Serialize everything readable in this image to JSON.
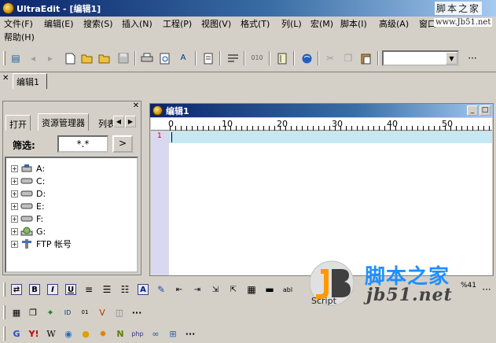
{
  "window": {
    "title": "UltraEdit - [编辑1]"
  },
  "watermarks": {
    "top": "脚本之家",
    "menu": "www.Jb51.net",
    "logo_cn": "脚本之家",
    "logo_url": "jb51.net",
    "logo_script": "Script"
  },
  "menu": {
    "items": [
      "文件(F)",
      "编辑(E)",
      "搜索(S)",
      "插入(N)",
      "工程(P)",
      "视图(V)",
      "格式(T)",
      "列(L)",
      "宏(M)",
      "脚本(I)",
      "高级(A)",
      "窗口"
    ],
    "help": "帮助(H)"
  },
  "toolbar": {
    "more": "···",
    "combo_value": ""
  },
  "tabs": {
    "document": "编辑1"
  },
  "left_pane": {
    "tabs": [
      "打开",
      "资源管理器",
      "列表"
    ],
    "filter_label": "筛选:",
    "filter_value": "*.*",
    "filter_go": ">",
    "tree": [
      "A:",
      "C:",
      "D:",
      "E:",
      "F:",
      "G:",
      "FTP 帐号"
    ]
  },
  "editor": {
    "title": "编辑1",
    "ruler": [
      "0",
      "10",
      "20",
      "30",
      "40",
      "50"
    ],
    "line_number": "1"
  },
  "format_toolbar": {
    "bold": "B",
    "italic": "I",
    "underline": "U",
    "zoom": "%41"
  },
  "colors": {
    "title_start": "#0a246a",
    "title_end": "#a6caf0",
    "current_line": "#c6e8f4",
    "gutter": "#d8d8f0"
  }
}
